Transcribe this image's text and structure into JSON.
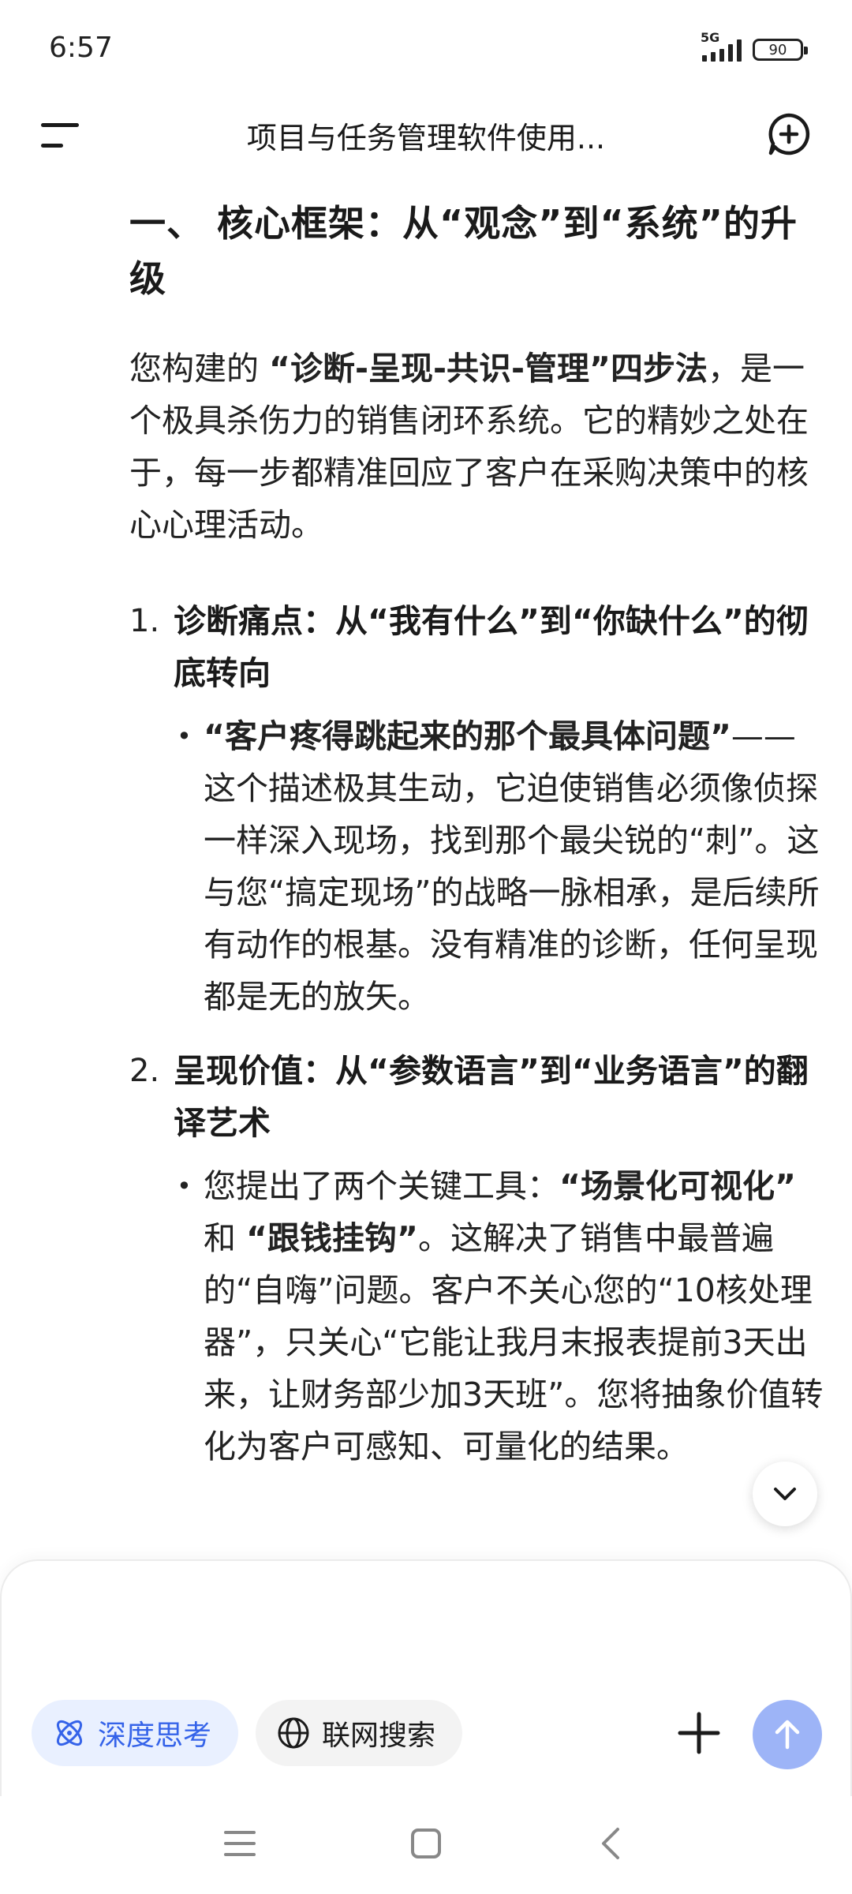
{
  "status_bar": {
    "time": "6:57",
    "network": "5G",
    "battery": "90"
  },
  "header": {
    "title": "项目与任务管理软件使用..."
  },
  "article": {
    "heading": "一、 核心框架：从“观念”到“系统”的升级",
    "intro": {
      "pre": "您构建的 ",
      "bold": "“诊断-呈现-共识-管理”四步法",
      "post": "，是一个极具杀伤力的销售闭环系统。它的精妙之处在于，每一步都精准回应了客户在采购决策中的核心心理活动。"
    },
    "items": [
      {
        "number": "1.",
        "heading": "诊断痛点：从“我有什么”到“你缺什么”的彻底转向",
        "bullet": {
          "bold": "“客户疼得跳起来的那个最具体问题”",
          "text": "——这个描述极其生动，它迫使销售必须像侦探一样深入现场，找到那个最尖锐的“刺”。这与您“搞定现场”的战略一脉相承，是后续所有动作的根基。没有精准的诊断，任何呈现都是无的放矢。"
        }
      },
      {
        "number": "2.",
        "heading": "呈现价值：从“参数语言”到“业务语言”的翻译艺术",
        "bullet": {
          "pre": "您提出了两个关键工具：",
          "bold1": "“场景化可视化”",
          "mid": " 和 ",
          "bold2": "“跟钱挂钩”",
          "text": "。这解决了销售中最普遍的“自嗨”问题。客户不关心您的“10核处理器”，只关心“它能让我月末报表提前3天出来，让财务部少加3天班”。您将抽象价值转化为客户可感知、可量化的结果。"
        }
      }
    ]
  },
  "composer": {
    "placeholder": "",
    "deep_think_label": "深度思考",
    "web_search_label": "联网搜索"
  },
  "colors": {
    "accent": "#3563e9",
    "accent_bg": "#e9f0ff",
    "send_button": "#9db4f7"
  },
  "icons": {
    "menu": "menu-icon",
    "new_chat": "new-chat-icon",
    "scroll_down": "chevron-down-icon",
    "deep_think": "atom-icon",
    "web_search": "globe-icon",
    "attach": "plus-icon",
    "send": "arrow-up-icon"
  }
}
